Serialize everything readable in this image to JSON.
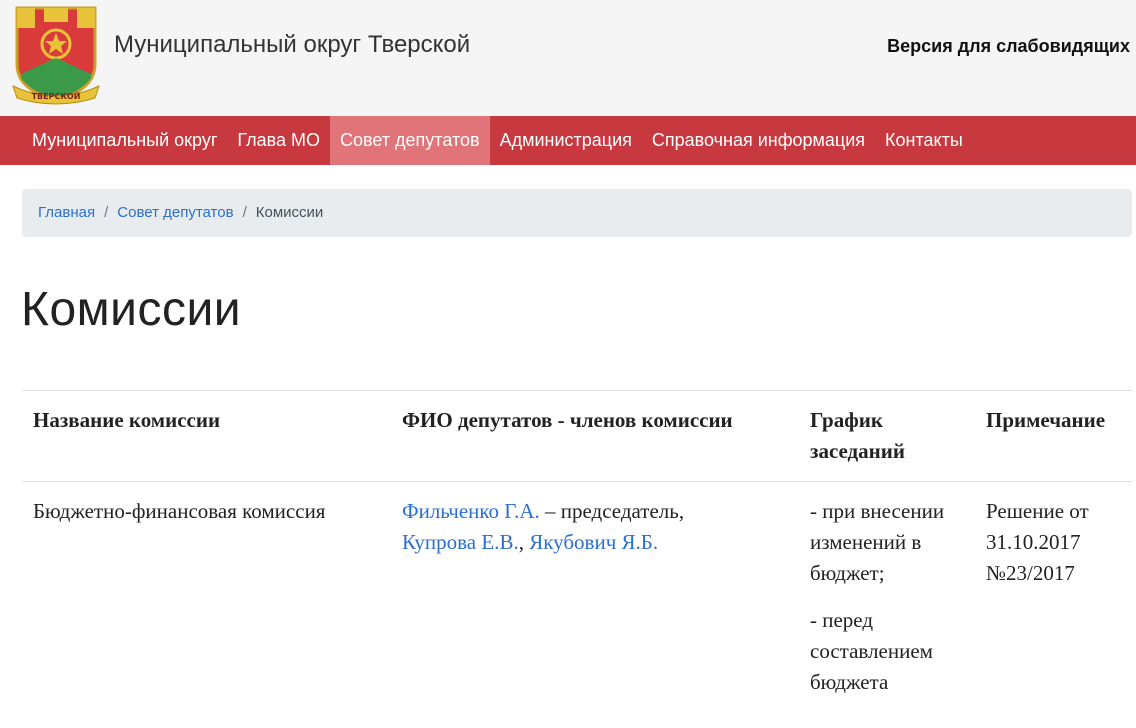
{
  "header": {
    "site_name": "Муниципальный округ Тверской",
    "vision_link": "Версия для слабовидящих",
    "logo_text": "ТВЕРСКОЙ"
  },
  "nav": {
    "items": [
      {
        "label": "Муниципальный округ"
      },
      {
        "label": "Глава МО"
      },
      {
        "label": "Совет депутатов",
        "active": true
      },
      {
        "label": "Администрация"
      },
      {
        "label": "Справочная информация"
      },
      {
        "label": "Контакты"
      }
    ]
  },
  "breadcrumb": {
    "home": "Главная",
    "council": "Совет депутатов",
    "current": "Комиссии",
    "separator": "/"
  },
  "page": {
    "title": "Комиссии"
  },
  "table": {
    "headers": [
      "Название комиссии",
      "ФИО депутатов - членов комиссии",
      "График заседаний",
      "Примечание"
    ],
    "rows": [
      {
        "name": "Бюджетно-финансовая комиссия",
        "member_1": "Фильченко Г.А.",
        "member_1_role": " – председатель,",
        "member_2": "Купрова Е.В.",
        "member_sep": ", ",
        "member_3": "Якубович Я.Б.",
        "schedule_1": "- при внесении изменений в бюджет;",
        "schedule_2": "- перед составлением бюджета",
        "note": "Решение от 31.10.2017 №23/2017"
      }
    ]
  },
  "colors": {
    "nav_bg": "#c8393f",
    "nav_active_bg": "#e07478",
    "link": "#2a6fd1",
    "header_bg": "#f5f5f5"
  }
}
